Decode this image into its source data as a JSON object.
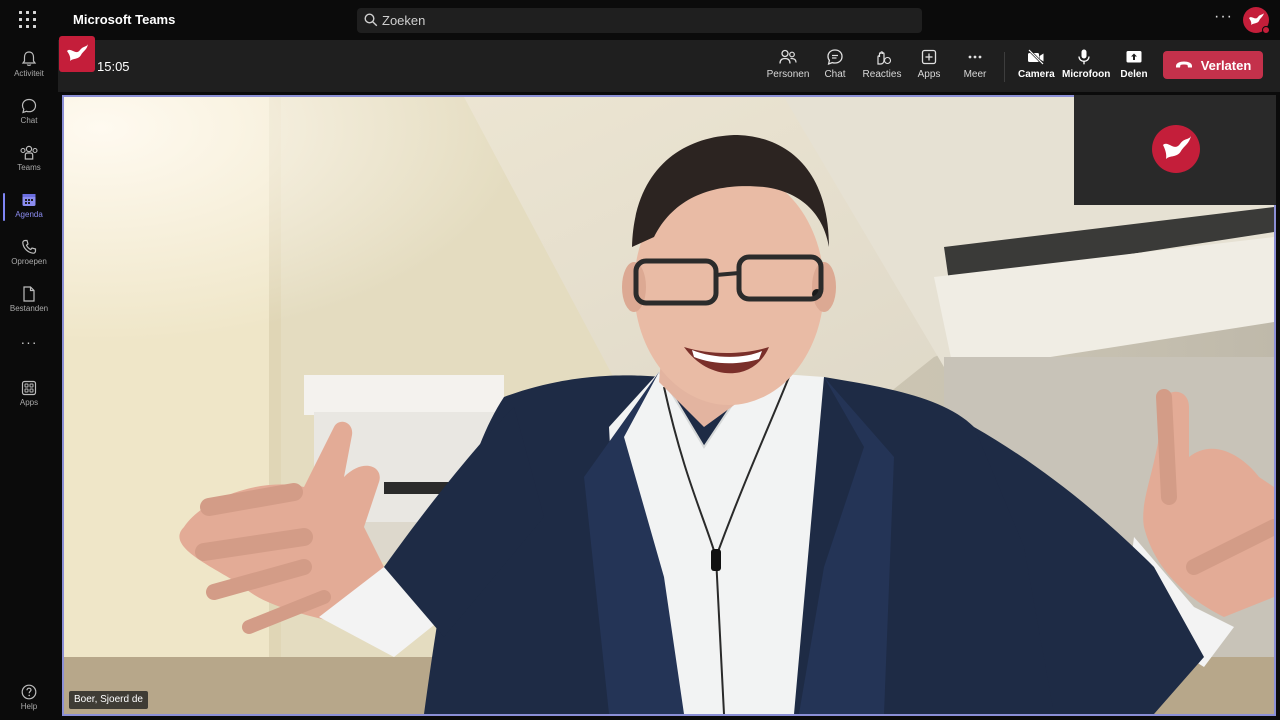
{
  "window": {
    "app_name": "Microsoft Teams"
  },
  "search": {
    "placeholder": "Zoeken"
  },
  "rail": {
    "items": [
      {
        "label": "Activiteit",
        "icon": "bell-icon"
      },
      {
        "label": "Chat",
        "icon": "chat-icon"
      },
      {
        "label": "Teams",
        "icon": "teams-icon"
      },
      {
        "label": "Agenda",
        "icon": "calendar-icon",
        "active": true
      },
      {
        "label": "Oproepen",
        "icon": "phone-icon"
      },
      {
        "label": "Bestanden",
        "icon": "file-icon"
      },
      {
        "label": "Apps",
        "icon": "apps-icon"
      },
      {
        "label": "Help",
        "icon": "help-icon"
      }
    ],
    "more": "···"
  },
  "meeting": {
    "time": "15:05",
    "controls": {
      "people": "Personen",
      "chat": "Chat",
      "reactions": "Reacties",
      "apps": "Apps",
      "more": "Meer",
      "camera": "Camera",
      "mic": "Microfoon",
      "share": "Delen"
    },
    "leave": "Verlaten"
  },
  "participant": {
    "name": "Boer, Sjoerd de"
  },
  "colors": {
    "accent": "#7f85f5",
    "leave": "#c4314b",
    "brand": "#c41e3a",
    "stage_border": "#8b8fd6"
  }
}
